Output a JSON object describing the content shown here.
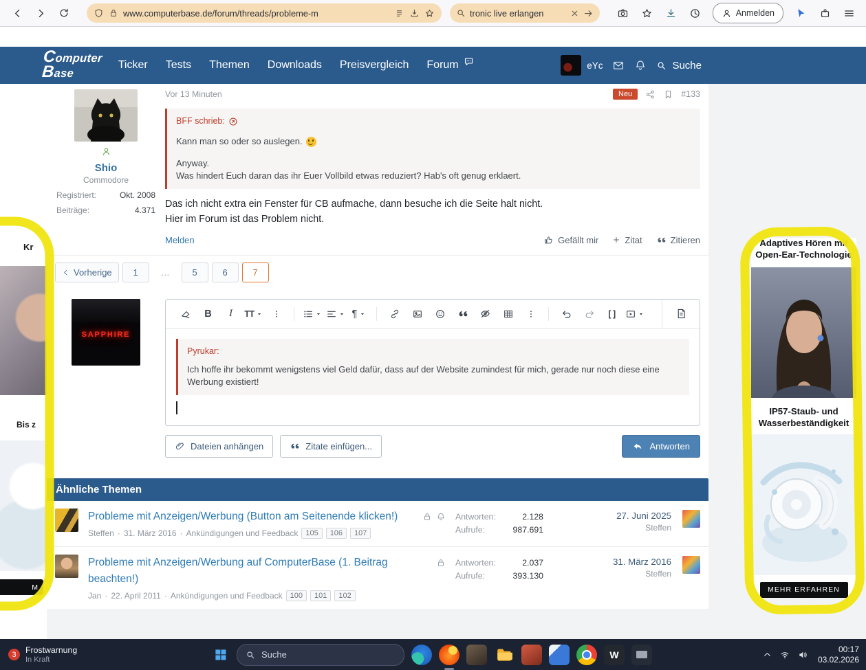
{
  "browser": {
    "url": "www.computerbase.de/forum/threads/probleme-m",
    "search_value": "tronic live erlangen",
    "login_label": "Anmelden"
  },
  "cb_header": {
    "logo_line1": "Computer",
    "logo_line2": "Base",
    "nav": [
      {
        "label": "Ticker"
      },
      {
        "label": "Tests"
      },
      {
        "label": "Themen"
      },
      {
        "label": "Downloads"
      },
      {
        "label": "Preisvergleich"
      },
      {
        "label": "Forum"
      }
    ],
    "username": "eYc",
    "search_label": "Suche"
  },
  "post": {
    "time": "Vor 13 Minuten",
    "new_badge": "Neu",
    "number": "#133",
    "author": {
      "name": "Shio",
      "rank": "Commodore",
      "registered_label": "Registriert:",
      "registered_value": "Okt. 2008",
      "posts_label": "Beiträge:",
      "posts_value": "4.371"
    },
    "quote": {
      "source": "BFF schrieb:",
      "line1": "Kann man so oder so auslegen.",
      "emoji": "wink-smiley",
      "line2": "Anyway.",
      "line3": "Was hindert Euch daran das ihr Euer Vollbild etwas reduziert? Hab's oft genug erklaert."
    },
    "body_line1": "Das ich nicht extra ein Fenster für CB aufmache, dann besuche ich die Seite halt nicht.",
    "body_line2": "Hier im Forum ist das Problem nicht.",
    "report_label": "Melden",
    "like_label": "Gefällt mir",
    "quote_label": "Zitat",
    "quote_now_label": "Zitieren"
  },
  "pagination": {
    "previous_label": "Vorherige",
    "pages": [
      "1",
      "…",
      "5",
      "6",
      "7"
    ],
    "current": "7"
  },
  "editor": {
    "avatar_text": "SAPPHIRE",
    "toolbar": {
      "bold": "B",
      "italic": "I",
      "size": "TT",
      "paragraph": "¶",
      "brackets": "[ ]"
    },
    "quote_author": "Pyrukar:",
    "quote_text": "Ich hoffe ihr bekommt wenigstens viel Geld dafür, dass auf der Website zumindest für mich, gerade nur noch diese eine Werbung existiert!",
    "attach_label": "Dateien anhängen",
    "quotes_label": "Zitate einfügen...",
    "reply_label": "Antworten"
  },
  "similar": {
    "title": "Ähnliche Themen",
    "meta_sep": "·",
    "replies_label": "Antworten:",
    "views_label": "Aufrufe:",
    "threads": [
      {
        "title": "Probleme mit Anzeigen/Werbung (Button am Seitenende klicken!)",
        "author": "Steffen",
        "date": "31. März 2016",
        "forum": "Ankündigungen und Feedback",
        "pages": [
          "105",
          "106",
          "107"
        ],
        "replies": "2.128",
        "views": "987.691",
        "last_date": "27. Juni 2025",
        "last_author": "Steffen"
      },
      {
        "title": "Probleme mit Anzeigen/Werbung auf ComputerBase (1. Beitrag beachten!)",
        "author": "Jan",
        "date": "22. April 2011",
        "forum": "Ankündigungen und Feedback",
        "pages": [
          "100",
          "101",
          "102"
        ],
        "replies": "2.037",
        "views": "393.130",
        "last_date": "31. März 2016",
        "last_author": "Steffen"
      }
    ]
  },
  "ads": {
    "right": {
      "headline_line1": "Adaptives Hören mit",
      "headline_line2": "Open-Ear-Technologie",
      "feature_line1": "IP57-Staub- und",
      "feature_line2": "Wasserbeständigkeit",
      "cta": "MEHR ERFAHREN"
    },
    "left": {
      "top_fragment": "Kr",
      "mid_fragment": "Bis z",
      "cta_fragment": "M"
    }
  },
  "taskbar": {
    "weather_badge": "3",
    "weather_line1": "Frostwarnung",
    "weather_line2": "In Kraft",
    "search_label": "Suche",
    "app_w_label": "W",
    "time": "00:17",
    "date": "03.02.2026"
  },
  "colors": {
    "cb_blue": "#2b5b8c",
    "accent_orange": "#e0762f",
    "quote_red": "#bd3d2c",
    "highlighter": "#f0e40e"
  }
}
